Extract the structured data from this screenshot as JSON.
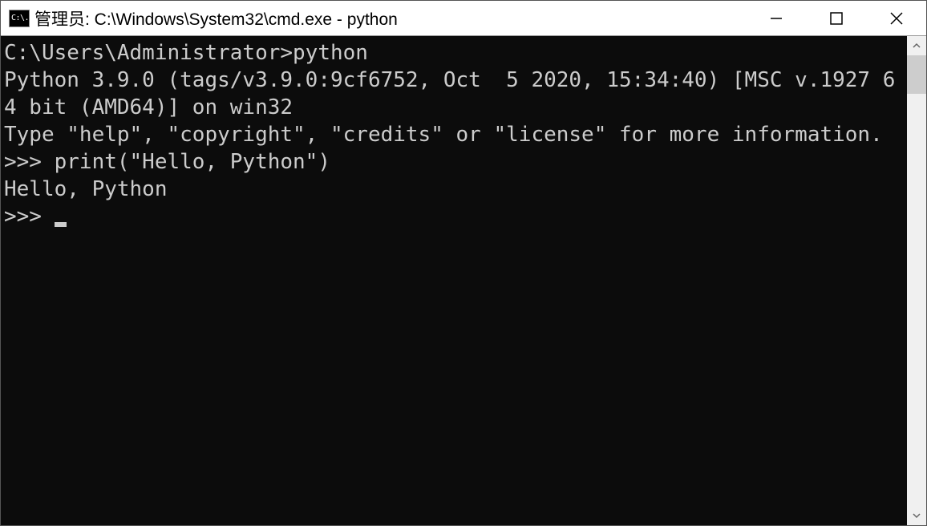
{
  "window": {
    "icon_text": "C:\\.",
    "title": "管理员: C:\\Windows\\System32\\cmd.exe - python"
  },
  "terminal": {
    "blank0": "",
    "line1": "C:\\Users\\Administrator>python",
    "line2": "Python 3.9.0 (tags/v3.9.0:9cf6752, Oct  5 2020, 15:34:40) [MSC v.1927 64 bit (AMD64)] on win32",
    "line3": "Type \"help\", \"copyright\", \"credits\" or \"license\" for more information.",
    "line4": ">>> print(\"Hello, Python\")",
    "line5": "Hello, Python",
    "prompt": ">>> "
  }
}
